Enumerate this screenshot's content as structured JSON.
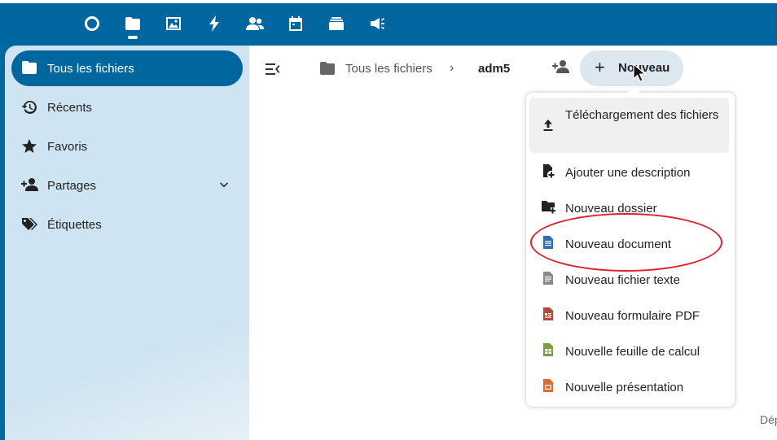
{
  "header": {
    "apps": [
      {
        "name": "dashboard-icon",
        "active": false
      },
      {
        "name": "files-icon",
        "active": true
      },
      {
        "name": "photos-icon",
        "active": false
      },
      {
        "name": "activity-icon",
        "active": false
      },
      {
        "name": "contacts-icon",
        "active": false
      },
      {
        "name": "calendar-icon",
        "active": false
      },
      {
        "name": "deck-icon",
        "active": false
      },
      {
        "name": "announcements-icon",
        "active": false
      }
    ],
    "color": "#00669f"
  },
  "sidebar": {
    "items": [
      {
        "label": "Tous les fichiers",
        "icon": "folder-icon",
        "active": true
      },
      {
        "label": "Récents",
        "icon": "history-icon",
        "active": false
      },
      {
        "label": "Favoris",
        "icon": "star-icon",
        "active": false
      },
      {
        "label": "Partages",
        "icon": "share-icon",
        "active": false,
        "expandable": true
      },
      {
        "label": "Étiquettes",
        "icon": "tags-icon",
        "active": false
      }
    ]
  },
  "breadcrumb": {
    "root": "Tous les fichiers",
    "current": "adm5"
  },
  "new_button": {
    "label": "Nouveau"
  },
  "new_menu": {
    "items": [
      {
        "label": "Téléchargement des fichiers",
        "icon": "upload-icon",
        "highlighted": true
      },
      {
        "label": "Ajouter une description",
        "icon": "file-add-icon"
      },
      {
        "label": "Nouveau dossier",
        "icon": "folder-add-icon"
      },
      {
        "label": "Nouveau document",
        "icon": "document-icon",
        "circled": true
      },
      {
        "label": "Nouveau fichier texte",
        "icon": "text-file-icon"
      },
      {
        "label": "Nouveau formulaire PDF",
        "icon": "pdf-form-icon"
      },
      {
        "label": "Nouvelle feuille de calcul",
        "icon": "spreadsheet-icon"
      },
      {
        "label": "Nouvelle présentation",
        "icon": "presentation-icon"
      }
    ]
  },
  "footer": {
    "partial_text": "Dép"
  },
  "colors": {
    "accent": "#00679e",
    "annotation": "#e0202a"
  }
}
